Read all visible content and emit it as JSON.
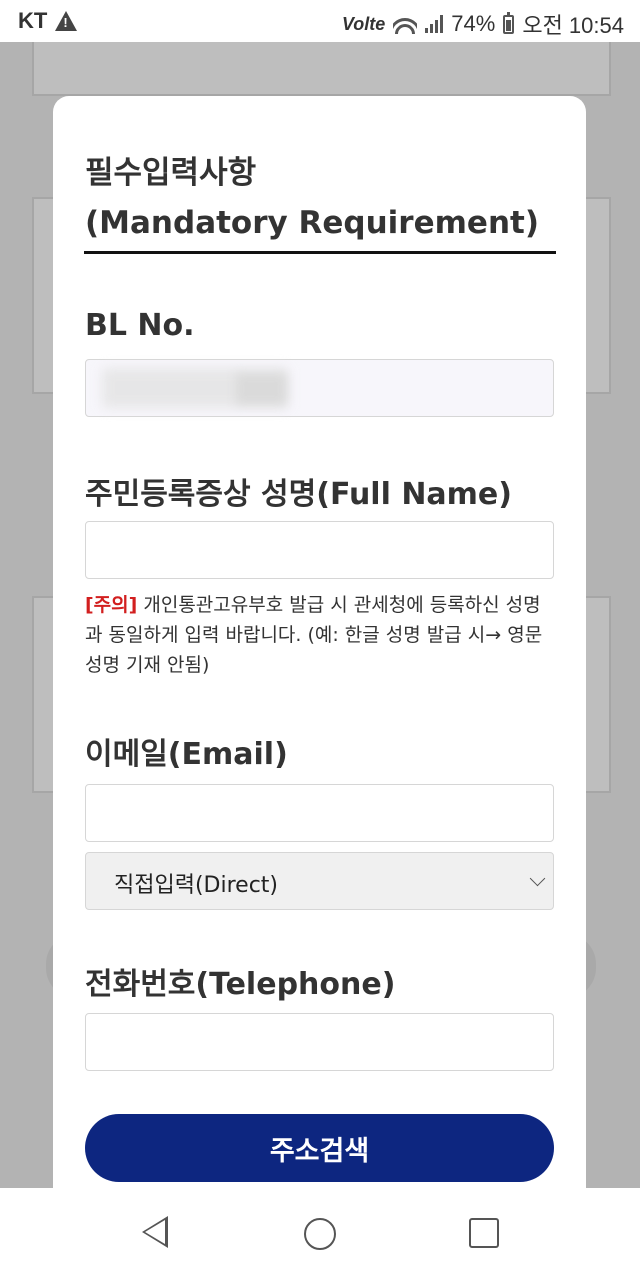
{
  "status_bar": {
    "carrier": "KT",
    "network": "Volte",
    "battery": "74%",
    "time": "오전 10:54"
  },
  "modal": {
    "title_line1": "필수입력사항",
    "title_line2": "(Mandatory Requirement)",
    "bl_label": "BL No.",
    "name_label": "주민등록증상 성명(Full Name)",
    "notice_tag": "[주의]",
    "notice_text": " 개인통관고유부호 발급 시 관세청에 등록하신 성명과 동일하게 입력 바랍니다. (예: 한글 성명 발급 시→ 영문 성명 기재 안됨)",
    "email_label": "이메일(Email)",
    "email_domain_selected": "직접입력(Direct)",
    "phone_label": "전화번호(Telephone)",
    "submit_label": "주소검색"
  }
}
